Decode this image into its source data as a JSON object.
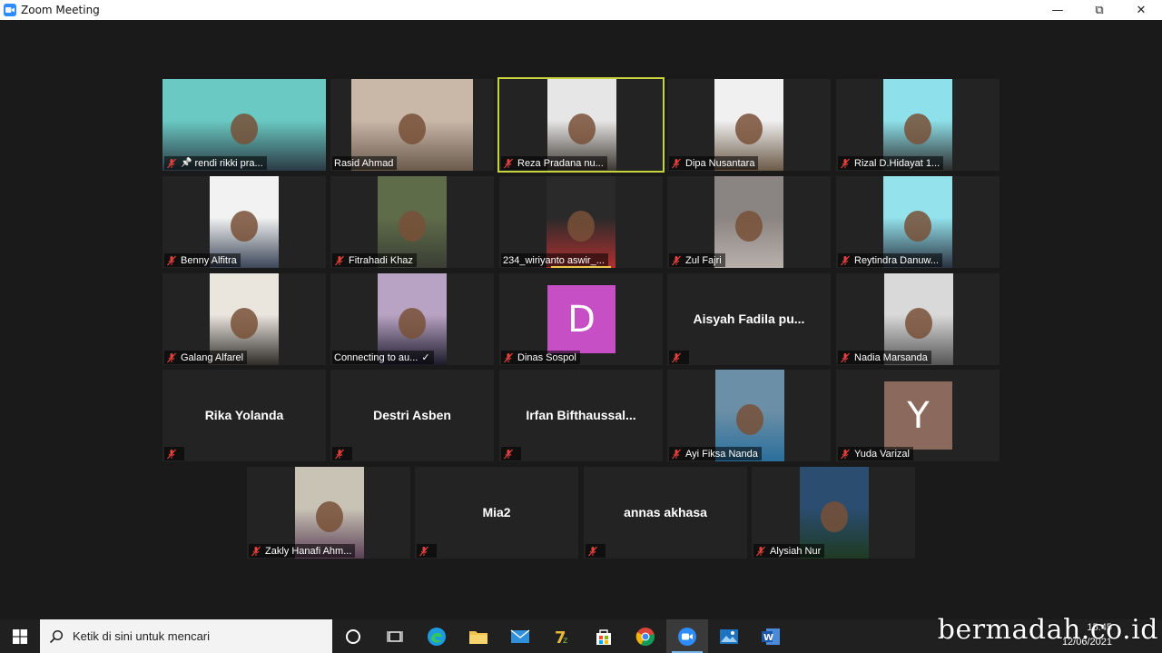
{
  "window": {
    "title": "Zoom Meeting",
    "min_glyph": "—",
    "max_glyph": "⧉",
    "close_glyph": "✕"
  },
  "participants": [
    {
      "name": "rendi rikki pra...",
      "type": "video",
      "pinned": true,
      "muted": true
    },
    {
      "name": "Rasid Ahmad",
      "type": "video",
      "muted": false
    },
    {
      "name": "Reza Pradana nu...",
      "type": "video",
      "muted": true,
      "active_speaker": true
    },
    {
      "name": "Dipa Nusantara",
      "type": "video",
      "muted": true
    },
    {
      "name": "Rizal D.Hidayat 1...",
      "type": "video",
      "muted": true
    },
    {
      "name": "Benny Alfitra",
      "type": "video",
      "muted": true
    },
    {
      "name": "Fitrahadi Khaz",
      "type": "video",
      "muted": true
    },
    {
      "name": "234_wiriyanto aswir_...",
      "type": "video",
      "muted": false
    },
    {
      "name": "Zul Fajri",
      "type": "video",
      "muted": true
    },
    {
      "name": "Reytindra Danuw...",
      "type": "video",
      "muted": true
    },
    {
      "name": "Galang Alfarel",
      "type": "video",
      "muted": true
    },
    {
      "name": "Connecting to au...",
      "type": "video",
      "muted": false,
      "connecting": true
    },
    {
      "name": "Dinas Sospol",
      "type": "avatar",
      "initial": "D",
      "avatar_color": "#c64fc5",
      "muted": true
    },
    {
      "name": "Aisyah Fadila pu...",
      "type": "name",
      "muted": true
    },
    {
      "name": "Nadia Marsanda",
      "type": "video",
      "muted": true
    },
    {
      "name": "Rika Yolanda",
      "type": "name",
      "muted": true
    },
    {
      "name": "Destri Asben",
      "type": "name",
      "muted": true
    },
    {
      "name": "Irfan  Bifthaussal...",
      "type": "name",
      "muted": true
    },
    {
      "name": "Ayi Fiksa Nanda",
      "type": "video",
      "muted": true
    },
    {
      "name": "Yuda Varizal",
      "type": "avatar",
      "initial": "Y",
      "avatar_color": "#8b6a5d",
      "muted": true
    },
    {
      "name": "Zakly Hanafi Ahm...",
      "type": "video",
      "muted": true
    },
    {
      "name": "Mia2",
      "type": "name",
      "muted": true
    },
    {
      "name": "annas akhasa",
      "type": "name",
      "muted": true
    },
    {
      "name": "Alysiah Nur",
      "type": "video",
      "muted": true
    }
  ],
  "taskbar": {
    "search_placeholder": "Ketik di sini untuk mencari",
    "apps": [
      "cortana-icon",
      "task-view-icon",
      "edge-icon",
      "file-explorer-icon",
      "mail-icon",
      "7zip-icon",
      "store-icon",
      "chrome-icon",
      "zoom-icon",
      "photos-icon",
      "word-icon"
    ],
    "time": "15:45",
    "date": "12/06/2021"
  },
  "watermark": "bermadah.co.id",
  "colors": {
    "active_speaker_border": "#c7d33c",
    "muted_icon": "#e8413d",
    "zoom_blue": "#2d8cff"
  }
}
